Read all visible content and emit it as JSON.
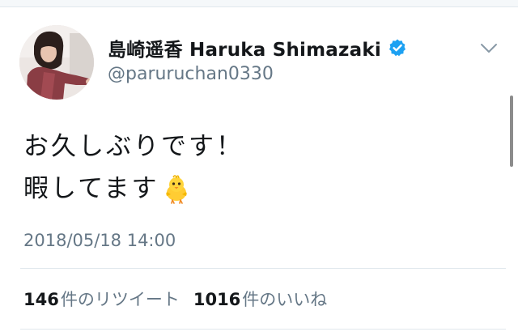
{
  "user": {
    "display_name": "島崎遥香 Haruka Shimazaki",
    "handle": "@paruruchan0330",
    "verified": true,
    "avatar_icon": "profile-photo",
    "verified_icon": "verified-badge-icon"
  },
  "tweet": {
    "lines": [
      "お久しぶりです！",
      "暇してます"
    ],
    "emoji": "baby-chick-icon",
    "timestamp": "2018/05/18 14:00"
  },
  "stats": {
    "retweets": {
      "count": "146",
      "label": "件のリツイート"
    },
    "likes": {
      "count": "1016",
      "label": "件のいいね"
    }
  },
  "menu": {
    "icon": "chevron-down-icon"
  },
  "colors": {
    "text": "#14171a",
    "secondary": "#657786",
    "verified_blue": "#1da1f2",
    "divider": "#e1e8ed"
  }
}
